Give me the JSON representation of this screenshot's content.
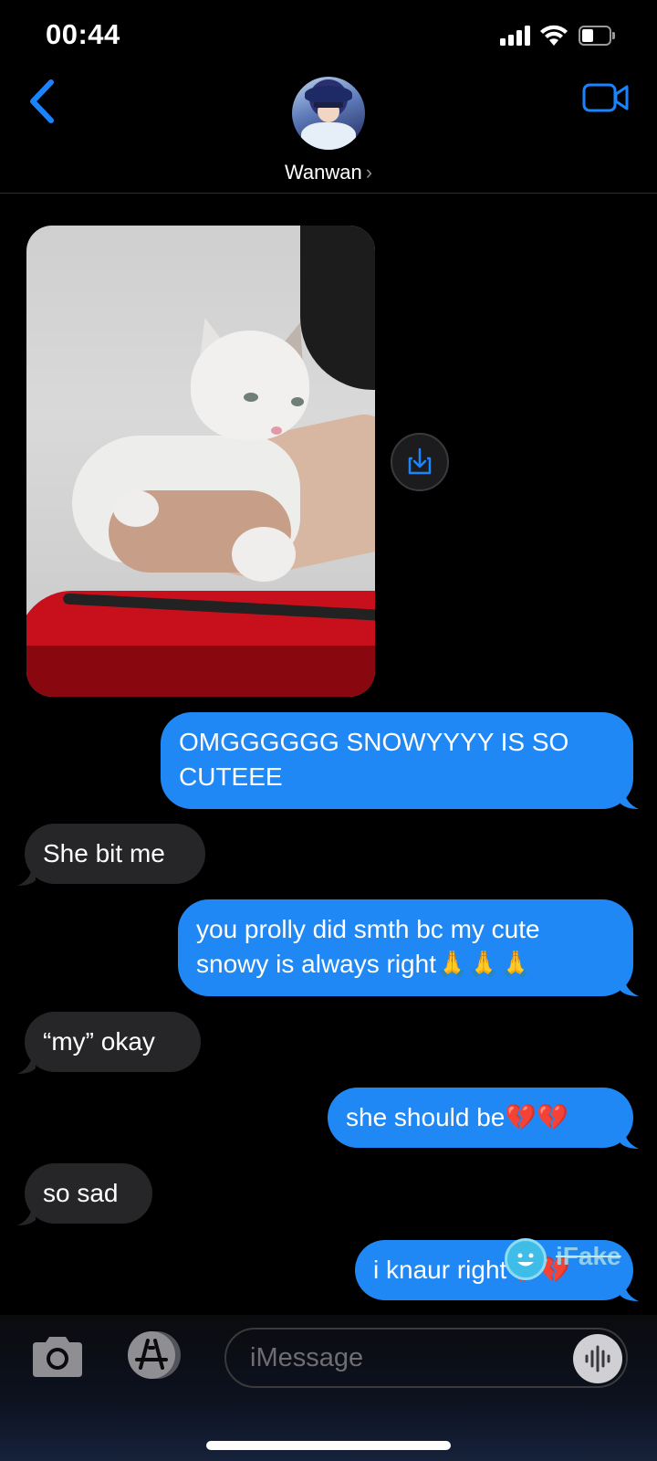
{
  "status_bar": {
    "time": "00:44"
  },
  "header": {
    "contact_name": "Wanwan",
    "chevron": "›",
    "icons": {
      "back": "chevron-left-icon",
      "video": "video-camera-icon"
    }
  },
  "attachment": {
    "type": "photo",
    "save_icon": "download-icon"
  },
  "messages": [
    {
      "direction": "outgoing",
      "text": "OMGGGGGG SNOWYYYY IS SO CUTEEE"
    },
    {
      "direction": "incoming",
      "text": "She bit me"
    },
    {
      "direction": "outgoing",
      "text": "you prolly did smth bc my cute snowy is always right🙏🙏🙏"
    },
    {
      "direction": "incoming",
      "text": "“my” okay"
    },
    {
      "direction": "outgoing",
      "text": "she should be💔💔"
    },
    {
      "direction": "incoming",
      "text": "so sad"
    },
    {
      "direction": "outgoing",
      "text": "i knaur right💔💔"
    }
  ],
  "watermark": {
    "text": "iFake"
  },
  "composer": {
    "placeholder": "iMessage",
    "icons": {
      "camera": "camera-icon",
      "apps": "app-store-icon",
      "audio": "audio-waveform-icon"
    }
  },
  "colors": {
    "outgoing": "#1f88f5",
    "incoming": "#262628",
    "accent": "#1a84ff",
    "background": "#000000"
  }
}
